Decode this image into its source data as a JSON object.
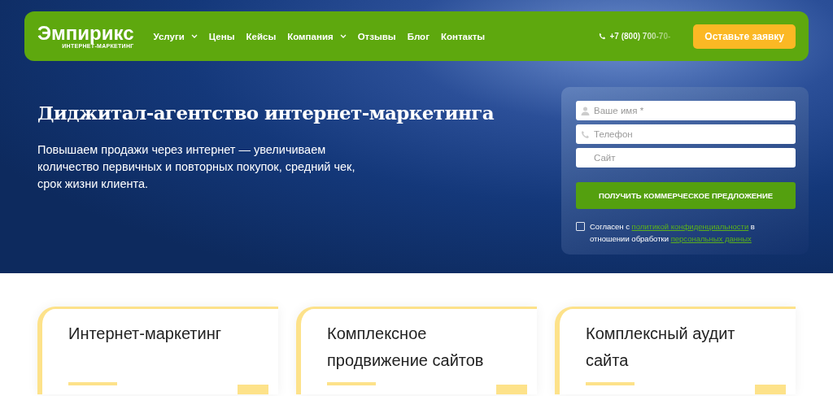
{
  "header": {
    "logo": {
      "name": "Эмпирикс",
      "tagline": "ИНТЕРНЕТ-МАРКЕТИНГ"
    },
    "nav": [
      {
        "label": "Услуги",
        "dropdown": true
      },
      {
        "label": "Цены",
        "dropdown": false
      },
      {
        "label": "Кейсы",
        "dropdown": false
      },
      {
        "label": "Компания",
        "dropdown": true
      },
      {
        "label": "Отзывы",
        "dropdown": false
      },
      {
        "label": "Блог",
        "dropdown": false
      },
      {
        "label": "Контакты",
        "dropdown": false
      }
    ],
    "phone": "+7 (800) 700-70-",
    "cta": "Оставьте заявку"
  },
  "hero": {
    "title": "Диджитал-агентство интернет-маркетинга",
    "text": "Повышаем продажи через интернет — увеличиваем количество первичных и повторных покупок, средний чек, срок жизни клиента."
  },
  "form": {
    "fields": [
      {
        "kind": "user",
        "placeholder": "Ваше имя *"
      },
      {
        "kind": "phone",
        "placeholder": "Телефон"
      },
      {
        "kind": "site",
        "placeholder": "Сайт"
      }
    ],
    "submit": "ПОЛУЧИТЬ КОММЕРЧЕСКОЕ ПРЕДЛОЖЕНИЕ",
    "consent": {
      "checked": false,
      "parts": [
        "Согласен с ",
        "политикой конфиденциальности",
        " в отношении обработки ",
        "персональных данных"
      ]
    }
  },
  "cards": [
    {
      "title": "Интернет-маркетинг"
    },
    {
      "title": "Комплексное продвижение сайтов"
    },
    {
      "title": "Комплексный аудит сайта"
    }
  ]
}
